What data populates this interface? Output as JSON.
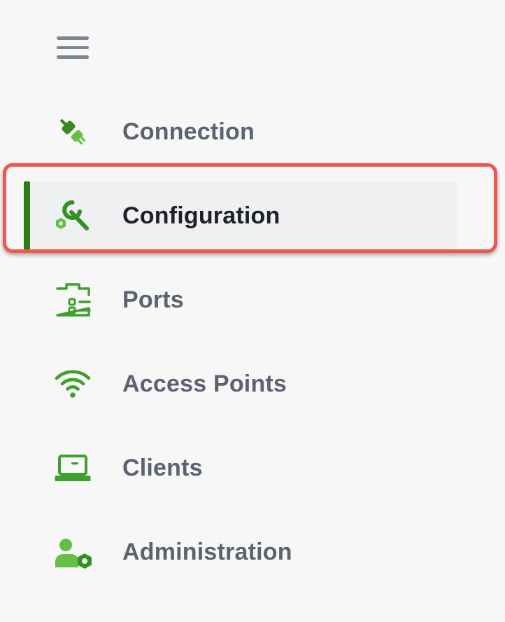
{
  "sidebar": {
    "menu_toggle_icon": "hamburger-menu-icon",
    "active_item": "Configuration",
    "accent_color": "#2e7d17",
    "icon_color": "#3f9f2a",
    "highlight_color": "#f0584e",
    "items": [
      {
        "label": "Connection",
        "icon": "plug-icon"
      },
      {
        "label": "Configuration",
        "icon": "wrench-icon"
      },
      {
        "label": "Ports",
        "icon": "ports-icon"
      },
      {
        "label": "Access Points",
        "icon": "wifi-icon"
      },
      {
        "label": "Clients",
        "icon": "laptop-icon"
      },
      {
        "label": "Administration",
        "icon": "admin-user-icon"
      }
    ]
  }
}
